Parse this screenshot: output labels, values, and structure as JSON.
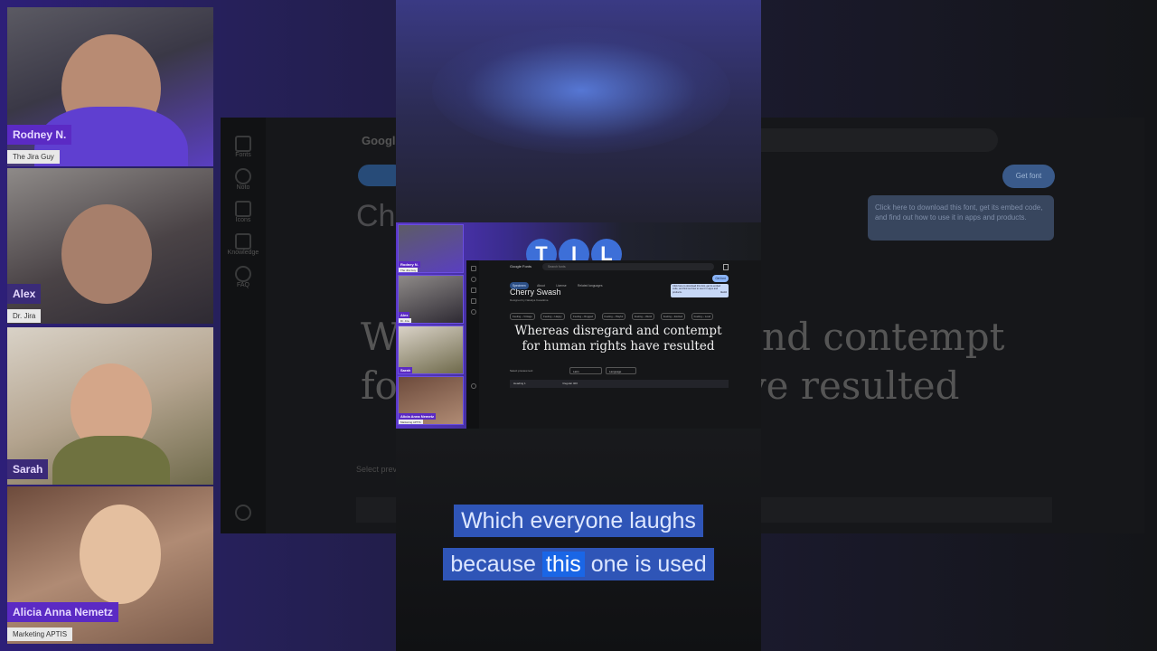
{
  "participants": [
    {
      "name": "Rodney N.",
      "role": "The Jira Guy"
    },
    {
      "name": "Alex",
      "role": "Dr. Jira"
    },
    {
      "name": "Sarah",
      "role": ""
    },
    {
      "name": "Alicia Anna Nemetz",
      "role": "Marketing APTIS"
    }
  ],
  "channel_logo": [
    "T",
    "I",
    "L"
  ],
  "google_fonts": {
    "logo": "Google Fonts",
    "search_placeholder": "Search fonts",
    "tabs": [
      "Specimen",
      "About",
      "License",
      "Related languages"
    ],
    "get_font": "Get font",
    "tooltip": "Click here to download this font, get its embed code, and find out how to use it in apps and products.",
    "tooltip_action": "Got it",
    "font_title": "Cherry Swash",
    "designer": "Designed by Nataliya Kasatkina",
    "chips": [
      "Feeling – Vintage",
      "Feeling – Happy",
      "Feeling – Rugged",
      "Feeling – Playful",
      "Feeling – Weird",
      "Feeling – Excited",
      "Feeling – Loud"
    ],
    "sample_text": "Whereas disregard and contempt for human rights have resulted",
    "bg_sample_line1": "Whereas disregard and contempt",
    "bg_sample_line2": "for human rights have resulted",
    "select_preview_label": "Select preview text:",
    "language_value": "Latin",
    "language_label": "Language",
    "toolbar_style": "Heading 1",
    "toolbar_size": "Regular 400"
  },
  "sidebar": [
    "Fonts",
    "Noto",
    "Icons",
    "Knowledge",
    "FAQ"
  ],
  "captions": {
    "line1": "Which everyone laughs",
    "line2_before": "because",
    "line2_highlight": "this",
    "line2_after": "one is used"
  }
}
